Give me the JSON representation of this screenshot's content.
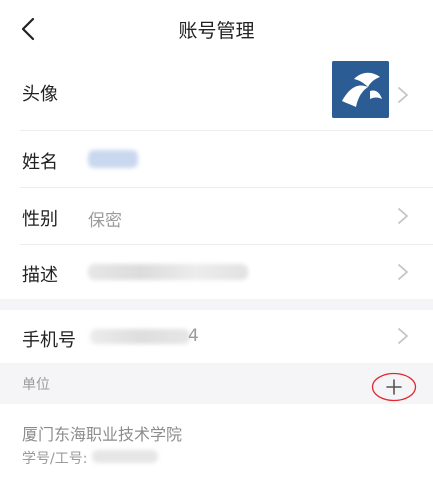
{
  "header": {
    "title": "账号管理",
    "back_icon": "chevron-left-icon"
  },
  "profile": {
    "avatar_label": "头像",
    "name_label": "姓名",
    "gender_label": "性别",
    "gender_value": "保密",
    "description_label": "描述",
    "phone_label": "手机号",
    "phone_value_visible_tail": "4"
  },
  "units": {
    "section_label": "单位",
    "add_icon": "plus-icon",
    "items": [
      {
        "name": "厦门东海职业技术学院",
        "id_label": "学号/工号:"
      }
    ]
  },
  "colors": {
    "avatar_bg": "#2b5c93",
    "annotation_circle": "#e0282e",
    "background": "#f5f5f7"
  }
}
